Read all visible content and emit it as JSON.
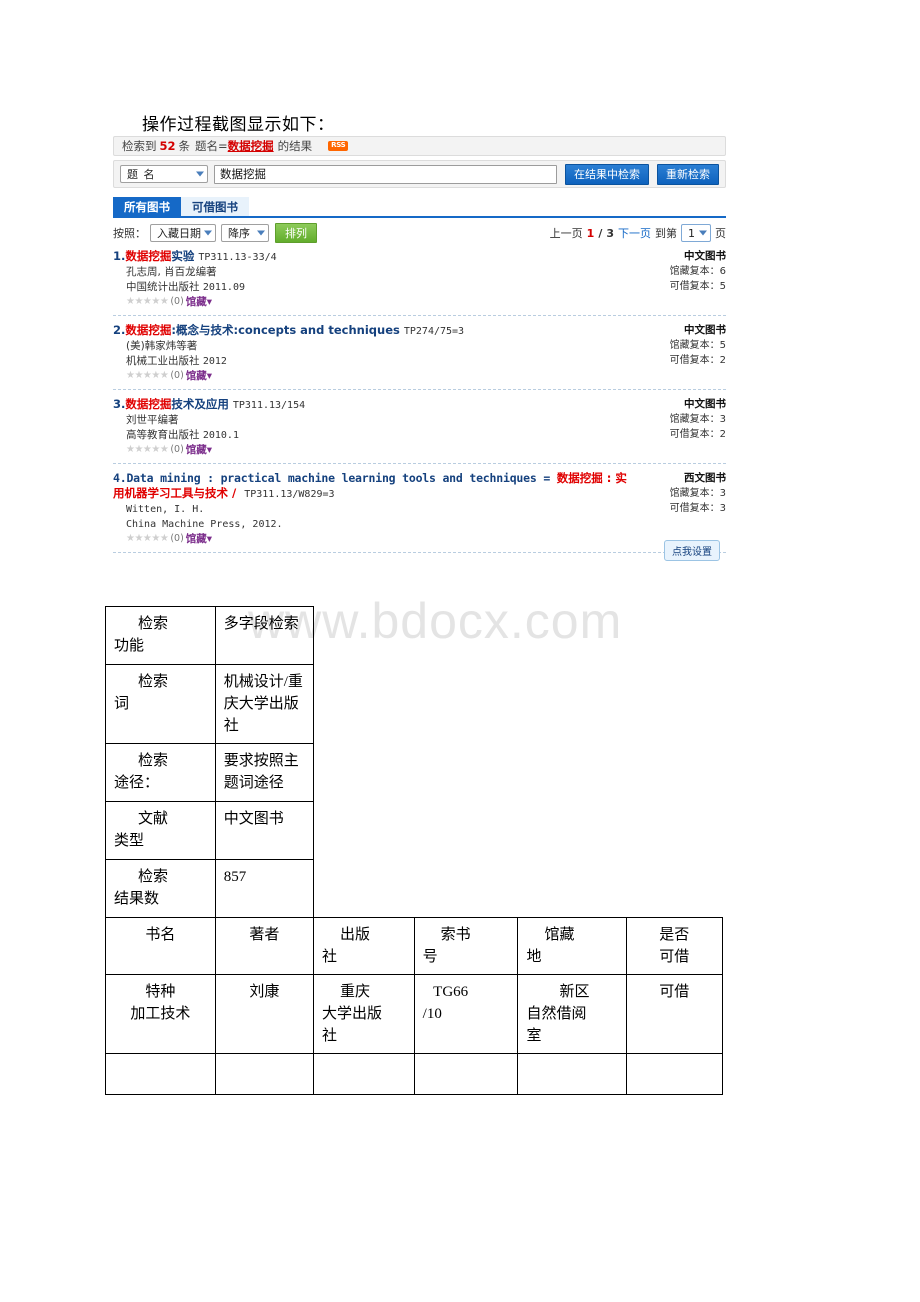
{
  "intro": "操作过程截图显示如下：",
  "watermark": "www.bdocx.com",
  "opac": {
    "result_bar": {
      "prefix": "检索到",
      "count": "52",
      "unit": "条",
      "field_label": "题名=",
      "keyword": "数据挖掘",
      "suffix": "的结果",
      "rss_label": "RSS"
    },
    "search": {
      "field_select": "题 名",
      "keyword_value": "数据挖掘",
      "search_in_results_button": "在结果中检索",
      "new_search_button": "重新检索"
    },
    "tabs": [
      {
        "label": "所有图书",
        "active": true
      },
      {
        "label": "可借图书",
        "active": false
      }
    ],
    "sort": {
      "label": "按照：",
      "by_select": "入藏日期",
      "order_select": "降序",
      "sort_button": "排列"
    },
    "pager": {
      "prev": "上一页",
      "current": "1",
      "slash": "/",
      "total": "3",
      "next": "下一页",
      "goto_label": "到第",
      "goto_value": "1",
      "page_unit": "页"
    },
    "results": [
      {
        "index": "1.",
        "title_hl": "数据挖掘",
        "title_rest": "实验",
        "call_no": "TP311.13-33/4",
        "author": "孔志周, 肖百龙编著",
        "publisher": "中国统计出版社",
        "year": "2011.09",
        "rating_count": "(0)",
        "holdings_link": "馆藏",
        "doc_type": "中文图书",
        "copies_label": "馆藏复本：",
        "copies": "6",
        "available_label": "可借复本：",
        "available": "5"
      },
      {
        "index": "2.",
        "title_hl": "数据挖掘",
        "title_rest": ":概念与技术:concepts and techniques",
        "call_no": "TP274/75=3",
        "author": "(美)韩家炜等著",
        "publisher": "机械工业出版社",
        "year": "2012",
        "rating_count": "(0)",
        "holdings_link": "馆藏",
        "doc_type": "中文图书",
        "copies_label": "馆藏复本：",
        "copies": "5",
        "available_label": "可借复本：",
        "available": "2"
      },
      {
        "index": "3.",
        "title_hl": "数据挖掘",
        "title_rest": "技术及应用",
        "call_no": "TP311.13/154",
        "author": "刘世平编著",
        "publisher": "高等教育出版社",
        "year": "2010.1",
        "rating_count": "(0)",
        "holdings_link": "馆藏",
        "doc_type": "中文图书",
        "copies_label": "馆藏复本：",
        "copies": "3",
        "available_label": "可借复本：",
        "available": "2"
      },
      {
        "index": "4.",
        "title_pre": "Data mining : practical machine learning tools and techniques = ",
        "title_hl": "数据挖掘",
        "title_rest": " : 实用机器学习工具与技术 / ",
        "call_no": "TP311.13/W829=3",
        "author": "Witten, I. H.",
        "publisher": "China Machine Press, 2012.",
        "year": "",
        "rating_count": "(0)",
        "holdings_link": "馆藏",
        "doc_type": "西文图书",
        "copies_label": "馆藏复本：",
        "copies": "3",
        "available_label": "可借复本：",
        "available": "3"
      }
    ],
    "settings_tip": "点我设置"
  },
  "table": {
    "rows": [
      {
        "label_a": "检索",
        "label_b": "功能",
        "value": "多字段检索"
      },
      {
        "label_a": "检索",
        "label_b": "词",
        "value": "机械设计/重庆大学出版社"
      },
      {
        "label_a": "检索",
        "label_b": "途径：",
        "value": "要求按照主题词途径"
      },
      {
        "label_a": "文献",
        "label_b": "类型",
        "value": "中文图书"
      },
      {
        "label_a": "检索",
        "label_b": "结果数",
        "value": "857"
      }
    ],
    "headers": {
      "book": "书名",
      "author": "著者",
      "pub_a": "出版",
      "pub_b": "社",
      "call_a": "索书",
      "call_b": "号",
      "loc_a": "馆藏",
      "loc_b": "地",
      "avail_a": "是否",
      "avail_b": "可借"
    },
    "data_row": {
      "book_a": "特种",
      "book_b": "加工技术",
      "author": "刘康",
      "pub_a": "重庆",
      "pub_b": "大学出版",
      "pub_c": "社",
      "call_a": "TG66",
      "call_b": "/10",
      "loc_a": "新区",
      "loc_b": "自然借阅",
      "loc_c": "室",
      "avail": "可借"
    }
  }
}
